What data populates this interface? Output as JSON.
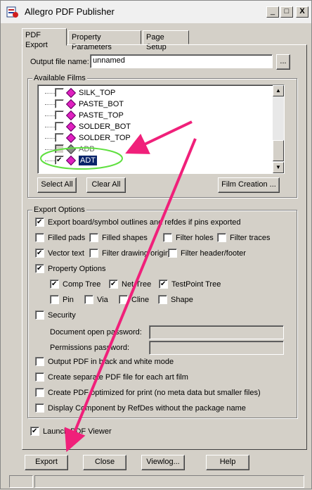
{
  "window": {
    "title": "Allegro PDF Publisher",
    "minimize": "_",
    "maximize": "□",
    "close": "X"
  },
  "tabs": [
    {
      "label": "PDF Export",
      "active": true
    },
    {
      "label": "Property Parameters",
      "active": false
    },
    {
      "label": "Page Setup",
      "active": false
    }
  ],
  "output": {
    "label": "Output file name:",
    "value": "unnamed",
    "browse_label": "..."
  },
  "films": {
    "group_label": "Available Films",
    "items": [
      {
        "label": "SILK_TOP",
        "checked": false,
        "icon": "pink-diamond-icon",
        "color": "#e020c0"
      },
      {
        "label": "PASTE_BOT",
        "checked": false,
        "icon": "pink-diamond-icon",
        "color": "#e020c0"
      },
      {
        "label": "PASTE_TOP",
        "checked": false,
        "icon": "pink-diamond-icon",
        "color": "#e020c0"
      },
      {
        "label": "SOLDER_BOT",
        "checked": false,
        "icon": "pink-diamond-icon",
        "color": "#e020c0"
      },
      {
        "label": "SOLDER_TOP",
        "checked": false,
        "icon": "pink-diamond-icon",
        "color": "#e020c0"
      },
      {
        "label": "ADB",
        "checked": false,
        "icon": "gray-diamond-icon",
        "color": "#8a8a8a"
      },
      {
        "label": "ADT",
        "checked": true,
        "icon": "pink-diamond-icon",
        "color": "#e020c0",
        "selected": true
      }
    ],
    "select_all": "Select All",
    "clear_all": "Clear All",
    "film_creation": "Film Creation ..."
  },
  "export_options": {
    "group_label": "Export Options",
    "board_outlines": {
      "label": "Export board/symbol outlines and refdes if pins exported",
      "checked": true
    },
    "filled_pads": {
      "label": "Filled pads",
      "checked": false
    },
    "filled_shapes": {
      "label": "Filled shapes",
      "checked": false
    },
    "filter_holes": {
      "label": "Filter holes",
      "checked": false
    },
    "filter_traces": {
      "label": "Filter traces",
      "checked": false
    },
    "vector_text": {
      "label": "Vector text",
      "checked": true
    },
    "filter_drawing_origin": {
      "label": "Filter drawing origin",
      "checked": false
    },
    "filter_header_footer": {
      "label": "Filter header/footer",
      "checked": false
    },
    "property_options": {
      "label": "Property Options",
      "checked": true
    },
    "comp_tree": {
      "label": "Comp Tree",
      "checked": true
    },
    "net_tree": {
      "label": "Net Tree",
      "checked": true
    },
    "testpoint_tree": {
      "label": "TestPoint Tree",
      "checked": true
    },
    "pin": {
      "label": "Pin",
      "checked": false
    },
    "via": {
      "label": "Via",
      "checked": false
    },
    "cline": {
      "label": "Cline",
      "checked": false
    },
    "shape": {
      "label": "Shape",
      "checked": false
    },
    "security": {
      "label": "Security",
      "checked": false
    },
    "doc_open_password": {
      "label": "Document open password:",
      "value": ""
    },
    "permissions_password": {
      "label": "Permissions password:",
      "value": ""
    },
    "black_white": {
      "label": "Output PDF in black and white mode",
      "checked": false
    },
    "separate_pdf": {
      "label": "Create separate PDF file for each art film",
      "checked": false
    },
    "optimized_print": {
      "label": "Create PDF optimized for print (no meta data but smaller files)",
      "checked": false
    },
    "display_refdes": {
      "label": "Display Component by RefDes without the package name",
      "checked": false
    }
  },
  "launch_viewer": {
    "label": "Launch PDF Viewer",
    "checked": true
  },
  "bottom_buttons": {
    "export": "Export",
    "close": "Close",
    "viewlog": "Viewlog...",
    "help": "Help"
  },
  "annotation_colors": {
    "arrow": "#f0207a",
    "highlight_ellipse": "#60e040"
  }
}
